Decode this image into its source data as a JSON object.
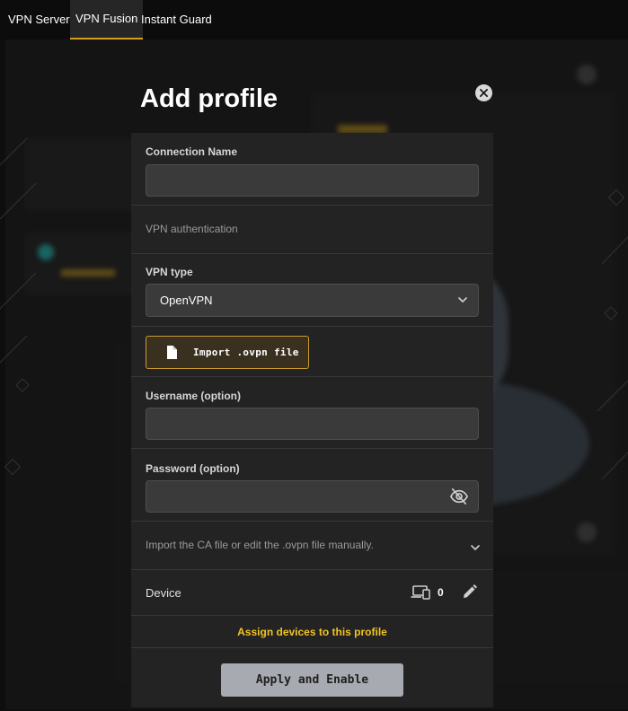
{
  "top_tabs": [
    {
      "label": "VPN Server",
      "active": false
    },
    {
      "label": "VPN Fusion",
      "active": true
    },
    {
      "label": "Instant Guard",
      "active": false
    }
  ],
  "accent_color": "#d4a017",
  "modal": {
    "title": "Add profile",
    "connection_name": {
      "label": "Connection Name",
      "value": ""
    },
    "vpn_authentication_label": "VPN authentication",
    "vpn_type": {
      "label": "VPN type",
      "selected": "OpenVPN"
    },
    "import_button_label": "Import .ovpn file",
    "username": {
      "label": "Username (option)",
      "value": ""
    },
    "password": {
      "label": "Password (option)",
      "value": ""
    },
    "ca_expander_label": "Import the CA file or edit the .ovpn file manually.",
    "device": {
      "label": "Device",
      "count": "0"
    },
    "assign_devices_link": "Assign devices to this profile",
    "apply_button_label": "Apply and Enable",
    "icons": {
      "close": "close-icon",
      "chevron": "chevron-down-icon",
      "file": "file-icon",
      "visibility": "eye-off-icon",
      "devices": "devices-icon",
      "edit": "pencil-icon"
    }
  }
}
